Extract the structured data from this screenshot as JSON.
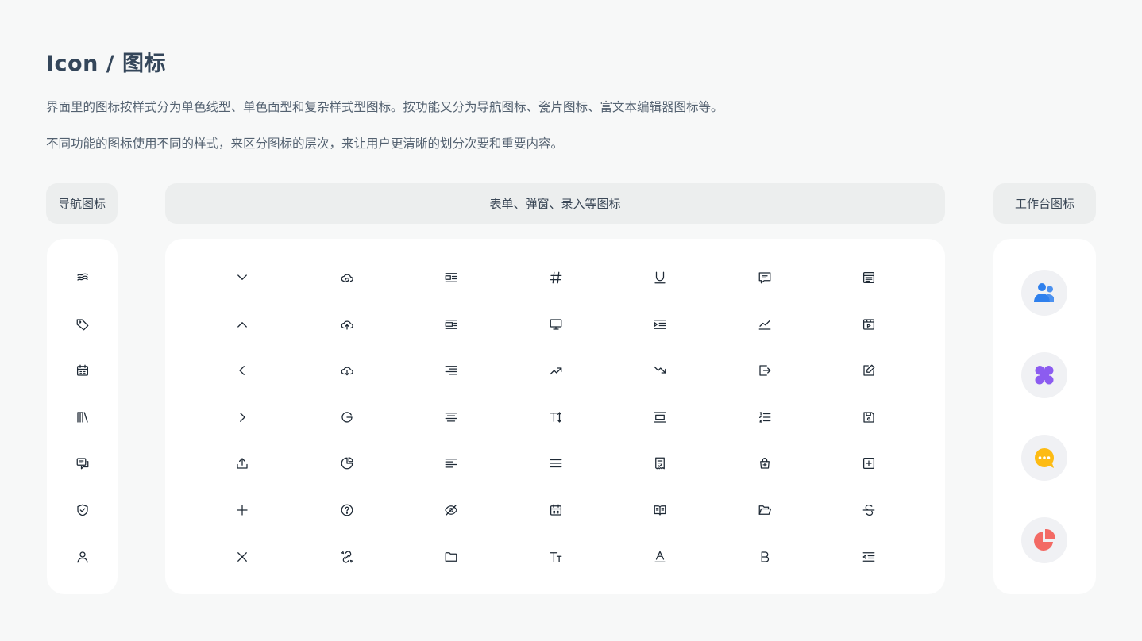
{
  "header": {
    "title": "Icon / 图标",
    "desc1": "界面里的图标按样式分为单色线型、单色面型和复杂样式型图标。按功能又分为导航图标、瓷片图标、富文本编辑器图标等。",
    "desc2": "不同功能的图标使用不同的样式，来区分图标的层次，来让用户更清晰的划分次要和重要内容。"
  },
  "sections": {
    "nav": "导航图标",
    "form": "表单、弹窗、录入等图标",
    "work": "工作台图标"
  },
  "nav_icons": [
    "waves-icon",
    "tag-icon",
    "calendar-icon",
    "books-icon",
    "message-screen-icon",
    "shield-check-icon",
    "user-icon"
  ],
  "form_icons": [
    [
      "chevron-down-icon",
      "cloud-sync-icon",
      "align-box-left-icon",
      "hashtag-icon",
      "underline-icon",
      "comment-icon",
      "list-box-icon"
    ],
    [
      "chevron-up-icon",
      "cloud-upload-icon",
      "align-box-right-icon",
      "monitor-icon",
      "indent-icon",
      "line-chart-icon",
      "video-frame-icon"
    ],
    [
      "chevron-left-icon",
      "cloud-download-icon",
      "align-right-icon",
      "trend-up-icon",
      "trend-down-icon",
      "export-icon",
      "edit-icon"
    ],
    [
      "chevron-right-icon",
      "refresh-icon",
      "align-center-icon",
      "text-height-icon",
      "text-wrap-icon",
      "ordered-list-icon",
      "save-icon"
    ],
    [
      "upload-icon",
      "pie-chart-icon",
      "align-left-icon",
      "menu-icon",
      "document-icon",
      "shopping-bag-add-icon",
      "plus-square-icon"
    ],
    [
      "plus-icon",
      "help-circle-icon",
      "eye-off-icon",
      "calendar-icon",
      "book-open-icon",
      "folder-open-icon",
      "strikethrough-icon"
    ],
    [
      "close-icon",
      "unlink-icon",
      "folder-icon",
      "font-size-icon",
      "font-color-icon",
      "bold-icon",
      "outdent-icon"
    ]
  ],
  "work_icons": [
    {
      "name": "users-icon",
      "color": "#2f80ed"
    },
    {
      "name": "apps-icon",
      "color": "#8c5cf0"
    },
    {
      "name": "chat-icon",
      "color": "#fdbb13"
    },
    {
      "name": "pie-chart-icon",
      "color": "#f36a64"
    }
  ]
}
